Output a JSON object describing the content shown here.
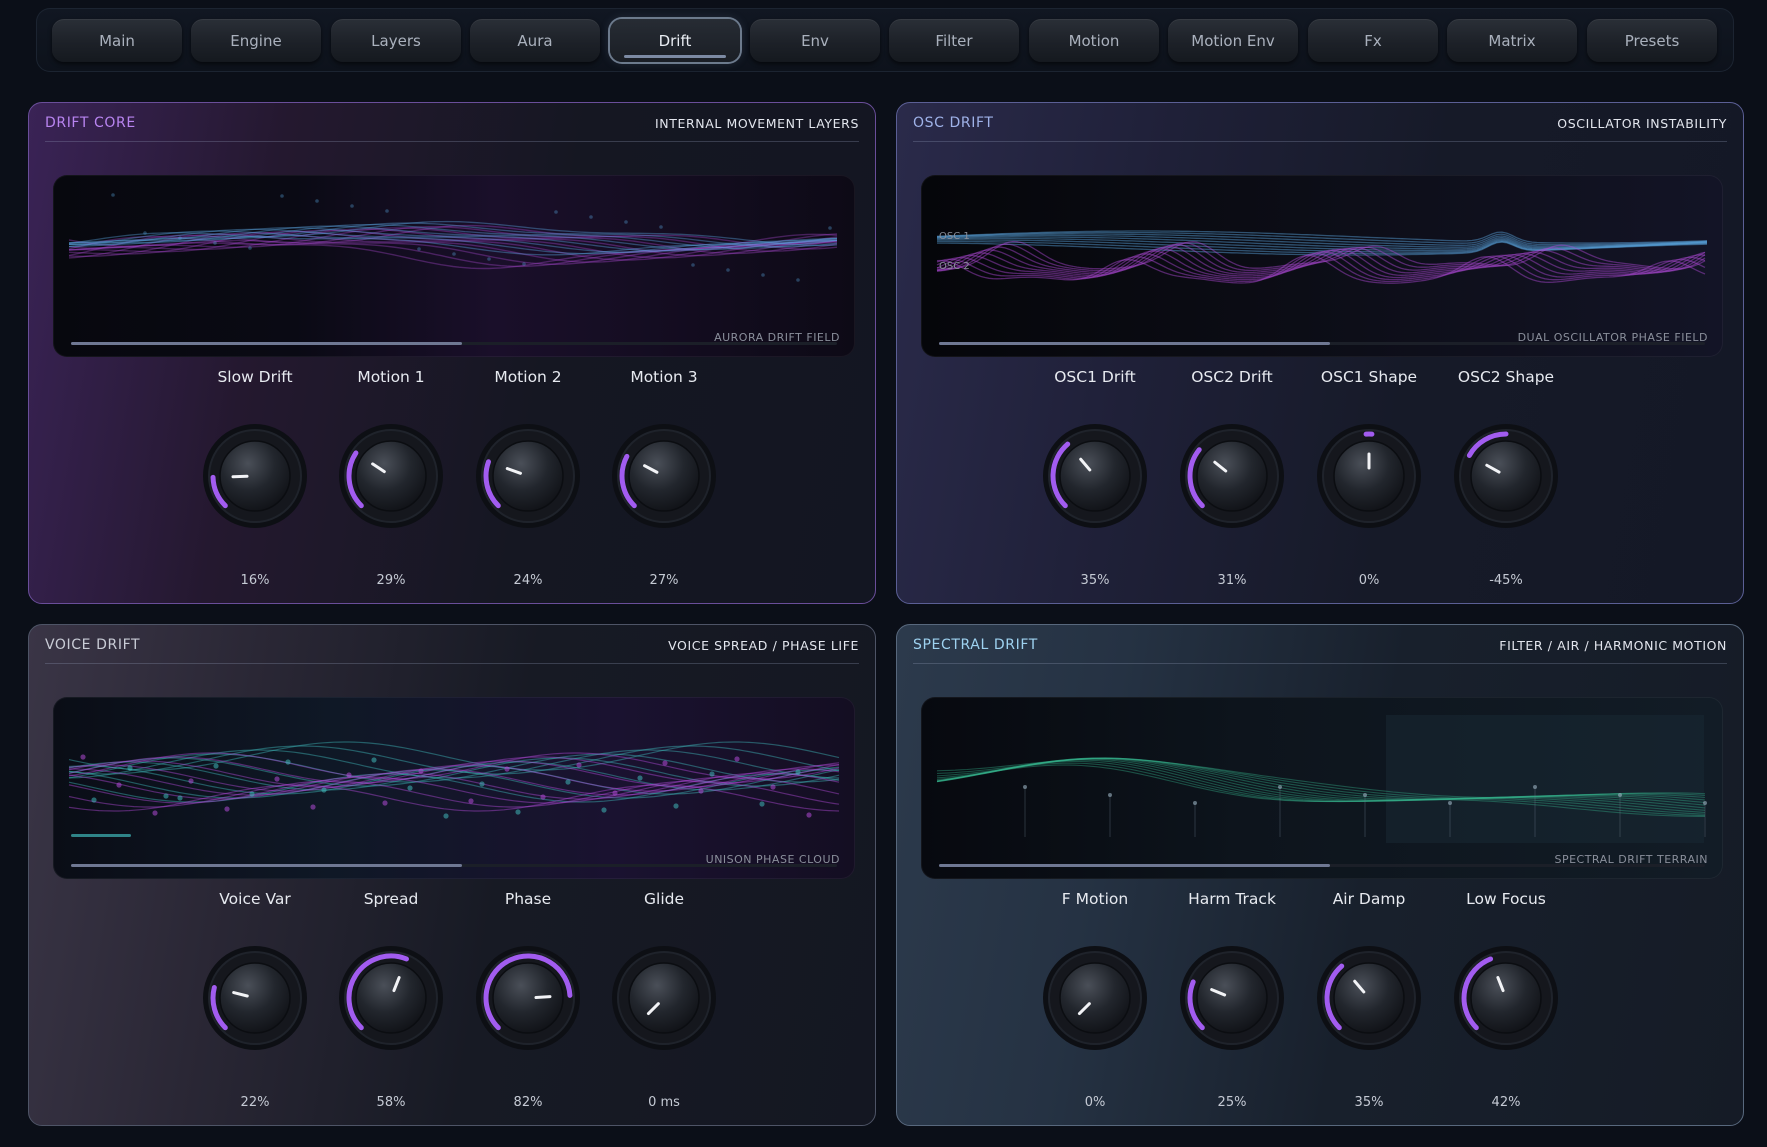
{
  "tabs": [
    {
      "label": "Main",
      "active": false
    },
    {
      "label": "Engine",
      "active": false
    },
    {
      "label": "Layers",
      "active": false
    },
    {
      "label": "Aura",
      "active": false
    },
    {
      "label": "Drift",
      "active": true
    },
    {
      "label": "Env",
      "active": false
    },
    {
      "label": "Filter",
      "active": false
    },
    {
      "label": "Motion",
      "active": false
    },
    {
      "label": "Motion Env",
      "active": false
    },
    {
      "label": "Fx",
      "active": false
    },
    {
      "label": "Matrix",
      "active": false
    },
    {
      "label": "Presets",
      "active": false
    }
  ],
  "colors": {
    "accent": "#a25cf0",
    "purple_wave": "#b04ad6",
    "blue_wave": "#5aa6e0",
    "teal_wave": "#3fb6b8",
    "green_wave": "#35b08a",
    "panel_title_purple": "#b884f0",
    "panel_title_blue": "#9fb2e8",
    "panel_title_grey": "#c9ccd6",
    "panel_title_teal": "#9ed2f0"
  },
  "panels": {
    "drift_core": {
      "title": "DRIFT CORE",
      "subtitle": "INTERNAL MOVEMENT LAYERS",
      "viz_label": "AURORA DRIFT FIELD",
      "scrub_position": 0.51,
      "knobs": [
        {
          "label": "Slow Drift",
          "value": "16%",
          "level": 0.16,
          "bipolar": false
        },
        {
          "label": "Motion 1",
          "value": "29%",
          "level": 0.29,
          "bipolar": false
        },
        {
          "label": "Motion 2",
          "value": "24%",
          "level": 0.24,
          "bipolar": false
        },
        {
          "label": "Motion 3",
          "value": "27%",
          "level": 0.27,
          "bipolar": false
        }
      ]
    },
    "osc_drift": {
      "title": "OSC DRIFT",
      "subtitle": "OSCILLATOR INSTABILITY",
      "viz_label": "DUAL OSCILLATOR PHASE FIELD",
      "osc1_label": "OSC 1",
      "osc2_label": "OSC 2",
      "scrub_position": 0.51,
      "knobs": [
        {
          "label": "OSC1 Drift",
          "value": "35%",
          "level": 0.35,
          "bipolar": false
        },
        {
          "label": "OSC2 Drift",
          "value": "31%",
          "level": 0.31,
          "bipolar": false
        },
        {
          "label": "OSC1 Shape",
          "value": "0%",
          "level": 0.0,
          "bipolar": true
        },
        {
          "label": "OSC2 Shape",
          "value": "-45%",
          "level": -0.45,
          "bipolar": true
        }
      ]
    },
    "voice_drift": {
      "title": "VOICE DRIFT",
      "subtitle": "VOICE SPREAD / PHASE LIFE",
      "viz_label": "UNISON PHASE CLOUD",
      "scrub_position": 0.51,
      "knobs": [
        {
          "label": "Voice Var",
          "value": "22%",
          "level": 0.22,
          "bipolar": false
        },
        {
          "label": "Spread",
          "value": "58%",
          "level": 0.58,
          "bipolar": false
        },
        {
          "label": "Phase",
          "value": "82%",
          "level": 0.82,
          "bipolar": false
        },
        {
          "label": "Glide",
          "value": "0 ms",
          "level": 0.0,
          "bipolar": false
        }
      ]
    },
    "spectral_drift": {
      "title": "SPECTRAL DRIFT",
      "subtitle": "FILTER / AIR / HARMONIC MOTION",
      "viz_label": "SPECTRAL DRIFT TERRAIN",
      "scrub_position": 0.51,
      "knobs": [
        {
          "label": "F Motion",
          "value": "0%",
          "level": 0.0,
          "bipolar": false
        },
        {
          "label": "Harm Track",
          "value": "25%",
          "level": 0.25,
          "bipolar": false
        },
        {
          "label": "Air Damp",
          "value": "35%",
          "level": 0.35,
          "bipolar": false
        },
        {
          "label": "Low Focus",
          "value": "42%",
          "level": 0.42,
          "bipolar": false
        }
      ]
    }
  }
}
